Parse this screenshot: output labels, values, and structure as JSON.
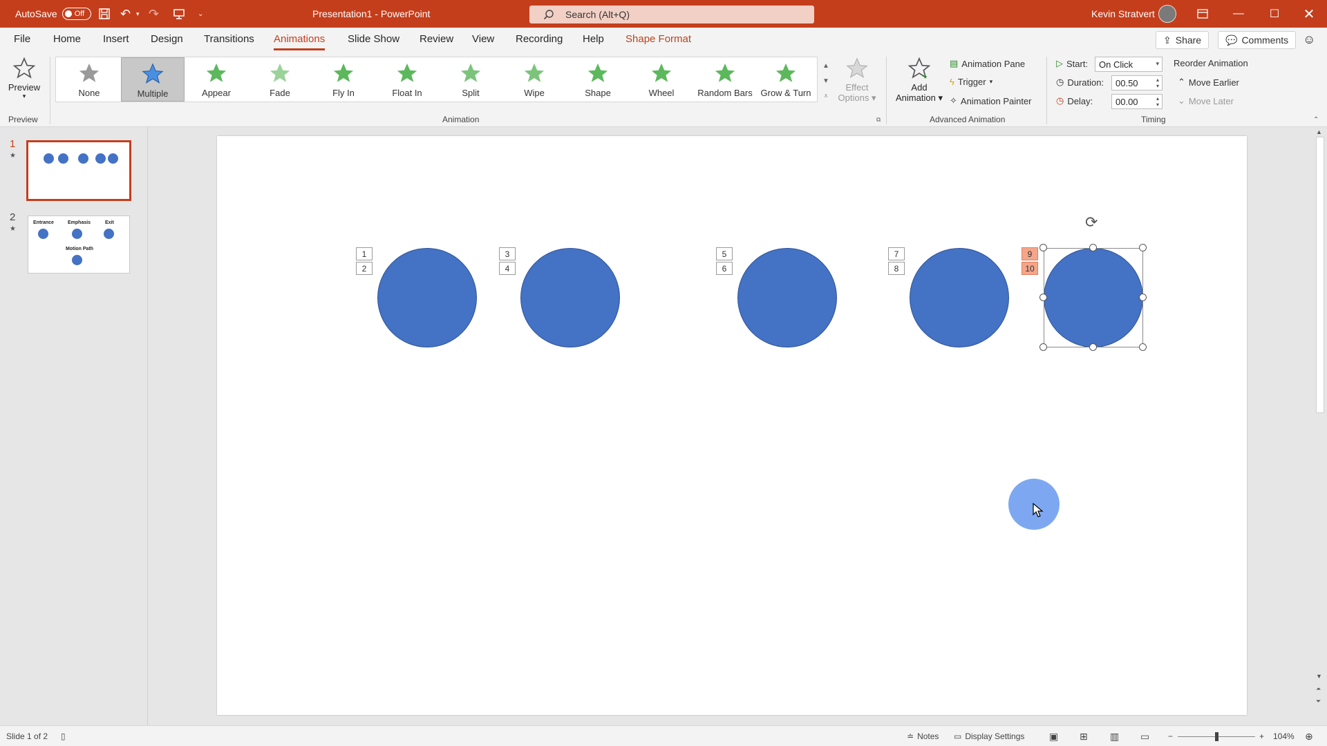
{
  "titlebar": {
    "autosave_label": "AutoSave",
    "autosave_state": "Off",
    "doc_title": "Presentation1  -  PowerPoint",
    "search_placeholder": "Search (Alt+Q)",
    "user_name": "Kevin Stratvert",
    "accent_color": "#c43e1c"
  },
  "tabs": [
    "File",
    "Home",
    "Insert",
    "Design",
    "Transitions",
    "Animations",
    "Slide Show",
    "Review",
    "View",
    "Recording",
    "Help",
    "Shape Format"
  ],
  "active_tab": "Animations",
  "share_label": "Share",
  "comments_label": "Comments",
  "ribbon": {
    "preview": {
      "label": "Preview",
      "group": "Preview"
    },
    "animation_group": "Animation",
    "animations": [
      "None",
      "Multiple",
      "Appear",
      "Fade",
      "Fly In",
      "Float In",
      "Split",
      "Wipe",
      "Shape",
      "Wheel",
      "Random Bars",
      "Grow & Turn"
    ],
    "selected_animation": "Multiple",
    "effect_options": [
      "Effect",
      "Options"
    ],
    "advanced_group": "Advanced Animation",
    "add_animation": [
      "Add",
      "Animation"
    ],
    "animation_pane": "Animation Pane",
    "trigger": "Trigger",
    "animation_painter": "Animation Painter",
    "timing_group": "Timing",
    "start_label": "Start:",
    "start_value": "On Click",
    "duration_label": "Duration:",
    "duration_value": "00.50",
    "delay_label": "Delay:",
    "delay_value": "00.00",
    "reorder_label": "Reorder Animation",
    "move_earlier": "Move Earlier",
    "move_later": "Move Later"
  },
  "slides": [
    {
      "number": "1",
      "selected": true
    },
    {
      "number": "2",
      "selected": false,
      "labels": [
        "Entrance",
        "Emphasis",
        "Exit",
        "Motion Path"
      ]
    }
  ],
  "canvas": {
    "shape_color": "#4472c4",
    "tags": [
      [
        "1",
        "2"
      ],
      [
        "3",
        "4"
      ],
      [
        "5",
        "6"
      ],
      [
        "7",
        "8"
      ],
      [
        "9",
        "10"
      ]
    ]
  },
  "statusbar": {
    "slide_info": "Slide 1 of 2",
    "notes": "Notes",
    "display_settings": "Display Settings",
    "zoom": "104%"
  }
}
